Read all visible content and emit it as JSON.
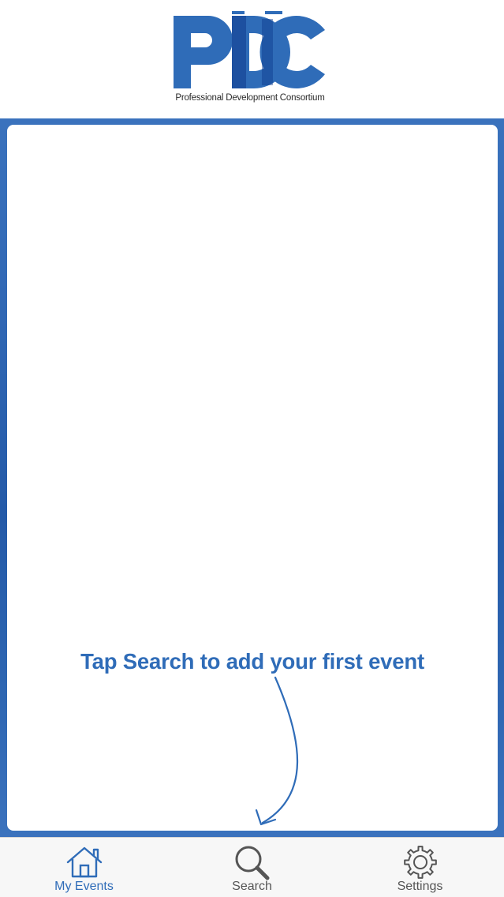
{
  "header": {
    "logo_text": "PDC",
    "logo_tagline": "Professional Development Consortium"
  },
  "main": {
    "empty_prompt": "Tap Search to add your first event"
  },
  "tabs": [
    {
      "label": "My Events",
      "icon": "house-icon",
      "selected": true
    },
    {
      "label": "Search",
      "icon": "magnifier-icon",
      "selected": false
    },
    {
      "label": "Settings",
      "icon": "gear-icon",
      "selected": false
    }
  ],
  "colors": {
    "brand_blue": "#2f6cb8",
    "brand_dark_blue": "#0e3a8c",
    "tab_active": "#2f6cb8",
    "tab_inactive": "#555555",
    "battery": "#3fd14a"
  }
}
